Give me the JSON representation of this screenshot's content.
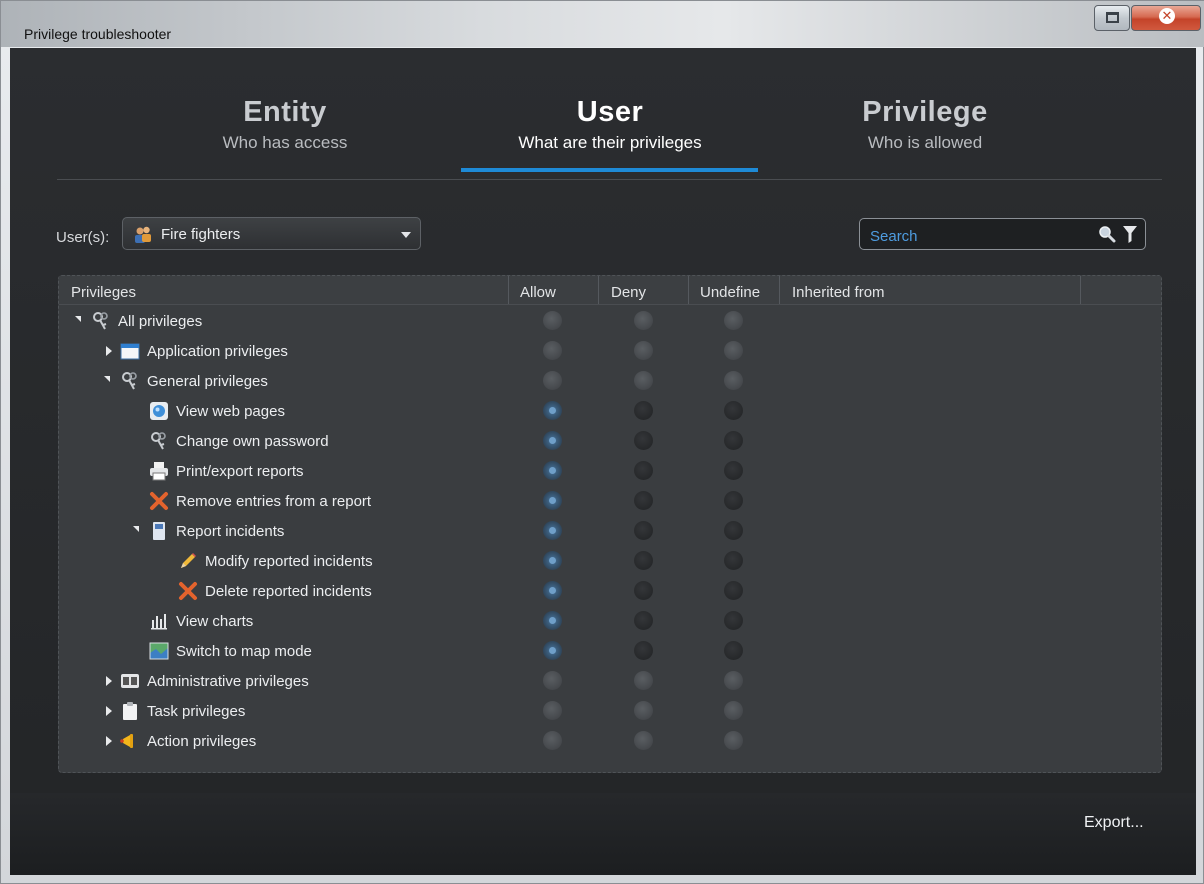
{
  "window": {
    "title": "Privilege troubleshooter"
  },
  "tabs": [
    {
      "title": "Entity",
      "subtitle": "Who has access",
      "active": false
    },
    {
      "title": "User",
      "subtitle": "What are their privileges",
      "active": true
    },
    {
      "title": "Privilege",
      "subtitle": "Who is allowed",
      "active": false
    }
  ],
  "user_picker": {
    "label": "User(s):",
    "value": "Fire fighters",
    "icon": "user-group-icon"
  },
  "search": {
    "placeholder": "Search"
  },
  "columns": [
    "Privileges",
    "Allow",
    "Deny",
    "Undefine",
    "Inherited from"
  ],
  "rows": [
    {
      "label": "All privileges",
      "icon": "key-icon",
      "level": 0,
      "expander": "open",
      "state": "inactive"
    },
    {
      "label": "Application privileges",
      "icon": "window-icon",
      "level": 1,
      "expander": "closed",
      "state": "inactive"
    },
    {
      "label": "General privileges",
      "icon": "key-icon",
      "level": 1,
      "expander": "open",
      "state": "inactive"
    },
    {
      "label": "View web pages",
      "icon": "web-page-icon",
      "level": 2,
      "expander": "none",
      "state": "allow"
    },
    {
      "label": "Change own password",
      "icon": "key-icon",
      "level": 2,
      "expander": "none",
      "state": "allow"
    },
    {
      "label": "Print/export reports",
      "icon": "printer-icon",
      "level": 2,
      "expander": "none",
      "state": "allow"
    },
    {
      "label": "Remove entries from a report",
      "icon": "delete-x-icon",
      "level": 2,
      "expander": "none",
      "state": "allow"
    },
    {
      "label": "Report incidents",
      "icon": "incident-report-icon",
      "level": 2,
      "expander": "open",
      "state": "allow"
    },
    {
      "label": "Modify reported incidents",
      "icon": "pencil-icon",
      "level": 3,
      "expander": "none",
      "state": "allow"
    },
    {
      "label": "Delete reported incidents",
      "icon": "delete-x-icon",
      "level": 3,
      "expander": "none",
      "state": "allow"
    },
    {
      "label": "View charts",
      "icon": "bar-chart-icon",
      "level": 2,
      "expander": "none",
      "state": "allow"
    },
    {
      "label": "Switch to map mode",
      "icon": "map-icon",
      "level": 2,
      "expander": "none",
      "state": "allow"
    },
    {
      "label": "Administrative privileges",
      "icon": "admin-icon",
      "level": 1,
      "expander": "closed",
      "state": "inactive"
    },
    {
      "label": "Task privileges",
      "icon": "clipboard-icon",
      "level": 1,
      "expander": "closed",
      "state": "inactive"
    },
    {
      "label": "Action privileges",
      "icon": "megaphone-icon",
      "level": 1,
      "expander": "closed",
      "state": "inactive"
    }
  ],
  "footer": {
    "export_label": "Export..."
  },
  "colors": {
    "accent": "#1e8ad6",
    "search_text": "#4e9ce0",
    "background": "#2b2d30"
  }
}
